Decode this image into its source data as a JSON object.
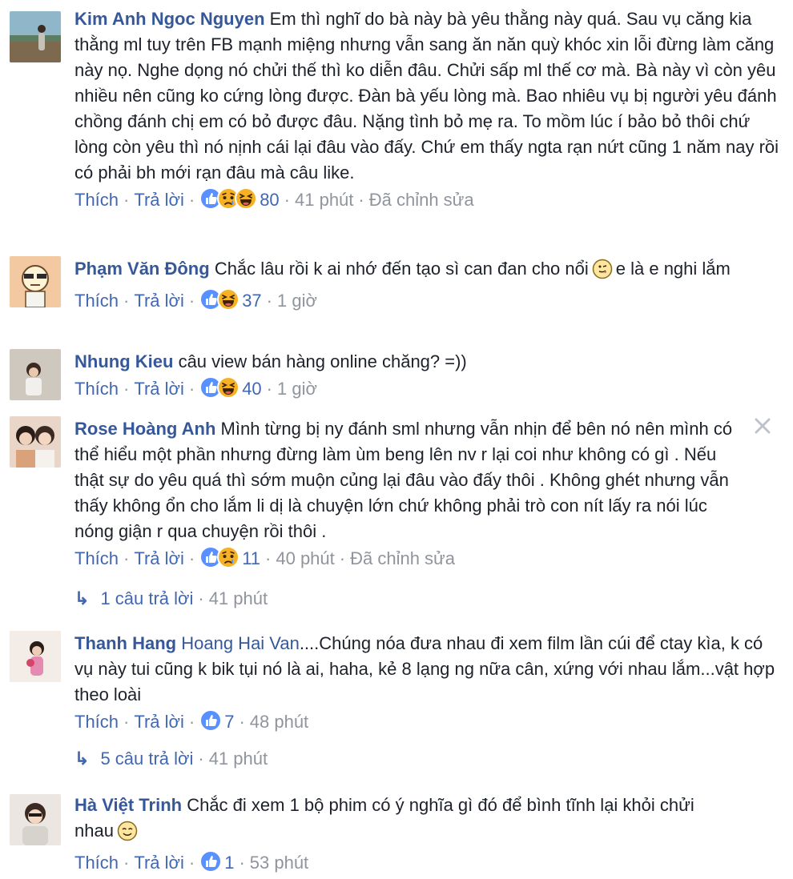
{
  "comments": [
    {
      "author": "Kim Anh Ngoc Nguyen",
      "text": "Em thì nghĩ do bà này bà yêu thằng này quá. Sau vụ căng kia thằng ml tuy trên FB mạnh miệng nhưng vẫn sang ăn năn quỳ khóc xin lỗi đừng làm căng này nọ. Nghe dọng nó chửi thế thì ko diễn đâu. Chửi sấp ml thế cơ mà. Bà này vì còn yêu nhiều nên cũng ko cứng lòng được. Đàn bà yếu lòng mà. Bao nhiêu vụ bị người yêu đánh chồng đánh chị em có bỏ được đâu. Nặng tình bỏ mẹ ra. To mồm lúc í bảo bỏ thôi chứ lòng còn yêu thì nó nịnh cái lại đâu vào đấy. Chứ em thấy ngta rạn nứt cũng 1 năm nay rồi có phải bh mới rạn đâu mà câu like.",
      "like_label": "Thích",
      "reply_label": "Trả lời",
      "reactions": [
        "like-icon",
        "sad-icon",
        "haha-icon"
      ],
      "reaction_count": "80",
      "time": "41 phút",
      "edited": "Đã chỉnh sửa"
    },
    {
      "author": "Phạm Văn Đông",
      "text_before": "Chắc lâu rồi k ai nhớ đến tạo sì can đan cho nổi",
      "inline_emoji": "tongue-emoji",
      "text_after": "e là e nghi lắm",
      "like_label": "Thích",
      "reply_label": "Trả lời",
      "reactions": [
        "like-icon",
        "haha-icon"
      ],
      "reaction_count": "37",
      "time": "1 giờ"
    },
    {
      "author": "Nhung Kieu",
      "text": "câu view bán hàng online chăng? =))",
      "like_label": "Thích",
      "reply_label": "Trả lời",
      "reactions": [
        "like-icon",
        "haha-icon"
      ],
      "reaction_count": "40",
      "time": "1 giờ"
    },
    {
      "author": "Rose Hoàng Anh",
      "text": "Mình từng bị ny đánh sml nhưng vẫn nhịn để bên nó nên mình có thể hiểu một phần nhưng đừng làm ùm beng lên nv r lại coi như không có gì . Nếu thật sự do yêu quá thì sớm muộn củng lại đâu vào đấy thôi . Không ghét nhưng vẫn thấy không ổn cho lắm li dị là chuyện lớn chứ không phải trò con nít lấy ra nói lúc nóng giận r qua chuyện rồi thôi .",
      "like_label": "Thích",
      "reply_label": "Trả lời",
      "reactions": [
        "like-icon",
        "sad-icon"
      ],
      "reaction_count": "11",
      "time": "40 phút",
      "edited": "Đã chỉnh sửa",
      "replies": "1 câu trả lời",
      "replies_time": "41 phút"
    },
    {
      "author": "Thanh Hang",
      "mention": "Hoang Hai Van",
      "text": "....Chúng nóa đưa nhau đi xem film lần cúi để ctay kìa, k có vụ này tui cũng k bik tụi nó là ai, haha, kẻ 8 lạng ng nữa cân, xứng với nhau lắm...vật hợp theo loài",
      "like_label": "Thích",
      "reply_label": "Trả lời",
      "reactions": [
        "like-icon"
      ],
      "reaction_count": "7",
      "time": "48 phút",
      "replies": "5 câu trả lời",
      "replies_time": "41 phút"
    },
    {
      "author": "Hà Việt Trinh",
      "text": "Chắc đi xem 1 bộ phim có ý nghĩa gì đó để bình tĩnh lại khỏi chửi nhau",
      "inline_emoji": "relieved-emoji",
      "like_label": "Thích",
      "reply_label": "Trả lời",
      "reactions": [
        "like-icon"
      ],
      "reaction_count": "1",
      "time": "53 phút"
    }
  ],
  "colors": {
    "link_blue": "#365899",
    "action_blue": "#4267b2",
    "meta_gray": "#90949c",
    "like_blue": "#5890ff",
    "emoji_yellow": "#f7b125"
  },
  "close_icon": "close-icon"
}
